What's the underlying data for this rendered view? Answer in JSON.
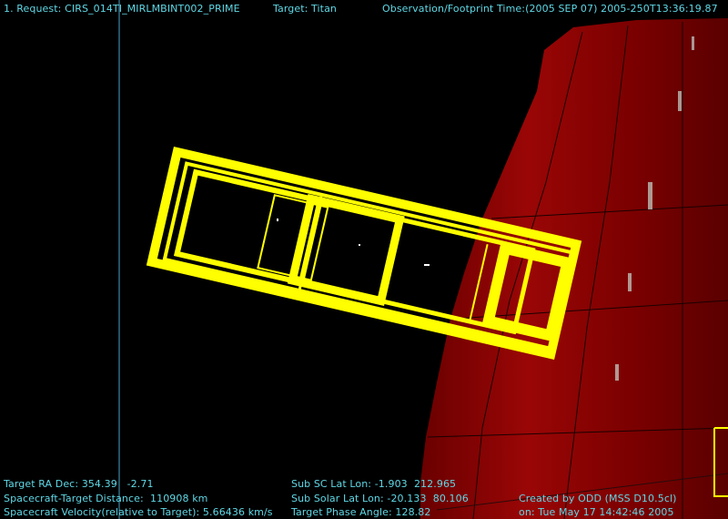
{
  "header": {
    "request": "1. Request: CIRS_014TI_MIRLMBINT002_PRIME",
    "target": "Target: Titan",
    "time": "Observation/Footprint Time:(2005 SEP 07) 2005-250T13:36:19.87"
  },
  "footer": {
    "ra_dec": "Target RA Dec: 354.39   -2.71",
    "distance": "Spacecraft-Target Distance:  110908 km",
    "velocity": "Spacecraft Velocity(relative to Target): 5.66436 km/s",
    "sub_sc": "Sub SC Lat Lon: -1.903  212.965",
    "sub_solar": "Sub Solar Lat Lon: -20.133  80.106",
    "phase": "Target Phase Angle: 128.82",
    "created_by": "Created by ODD (MSS D10.5cl)",
    "created_on": "on: Tue May 17 14:42:46 2005"
  },
  "colors": {
    "text": "#5fd8e6",
    "footprint": "#ffff00",
    "planet": "#8a0000",
    "crosshair": "#4aa3c8"
  }
}
